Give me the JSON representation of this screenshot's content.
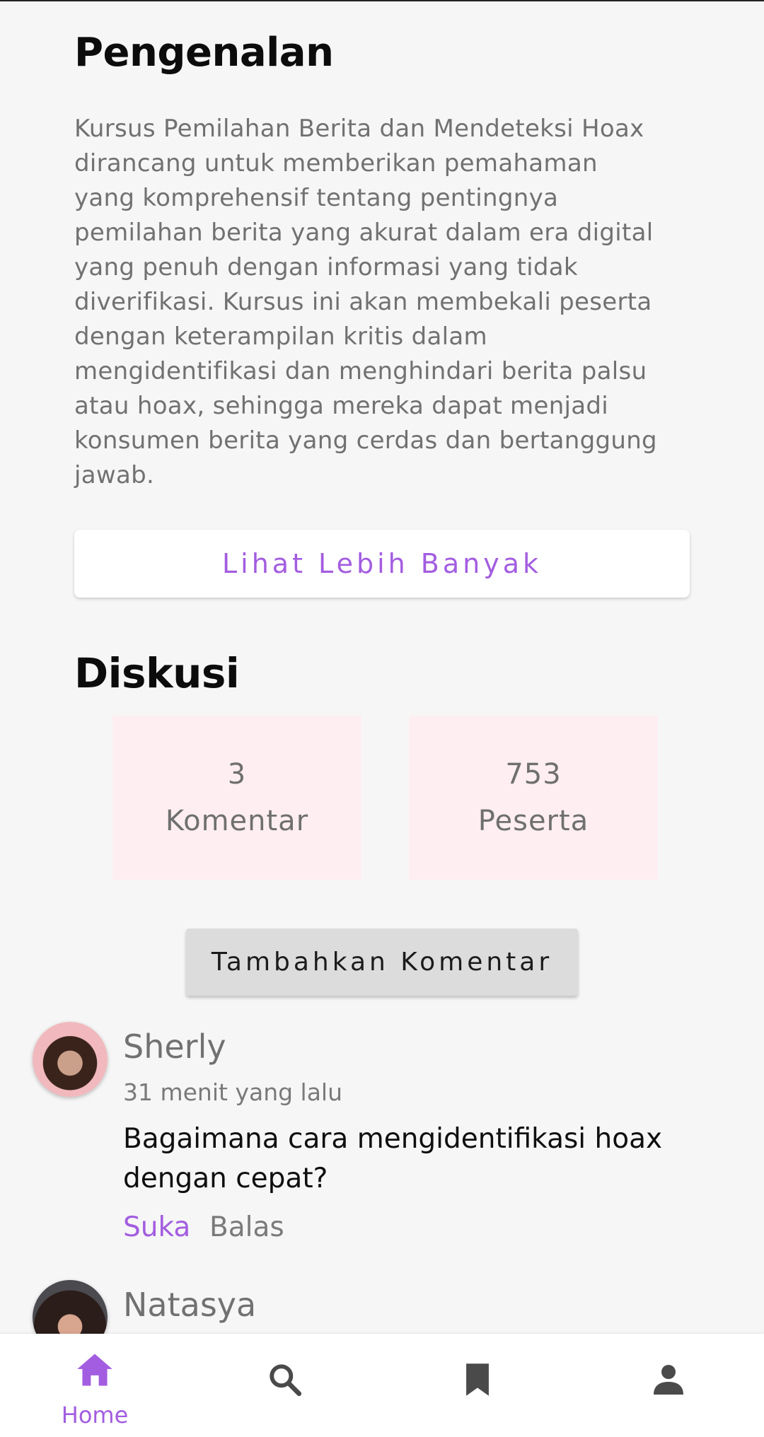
{
  "intro": {
    "title": "Pengenalan",
    "body": "Kursus Pemilahan Berita dan Mendeteksi Hoax dirancang untuk memberikan pemahaman yang komprehensif tentang pentingnya pemilahan berita yang akurat dalam era digital yang penuh dengan informasi yang tidak diverifikasi. Kursus ini akan membekali peserta dengan keterampilan kritis dalam mengidentifikasi dan menghindari berita palsu atau hoax, sehingga mereka dapat menjadi konsumen berita yang cerdas dan bertanggung jawab.",
    "more_button": "Lihat Lebih Banyak"
  },
  "discussion": {
    "title": "Diskusi",
    "stats": [
      {
        "value": "3",
        "label": "Komentar"
      },
      {
        "value": "753",
        "label": "Peserta"
      }
    ],
    "add_button": "Tambahkan Komentar",
    "comments": [
      {
        "name": "Sherly",
        "time": "31 menit yang lalu",
        "text": "Bagaimana cara mengidentifikasi hoax dengan cepat?",
        "like": "Suka",
        "reply": "Balas"
      },
      {
        "name": "Natasya"
      }
    ]
  },
  "nav": {
    "items": [
      {
        "label": "Home",
        "icon": "home-icon",
        "active": true
      },
      {
        "icon": "search-icon"
      },
      {
        "icon": "bookmark-icon"
      },
      {
        "icon": "profile-icon"
      }
    ]
  },
  "colors": {
    "accent": "#a35de0",
    "stat_card_bg": "#ffeef1",
    "background": "#f6f6f6",
    "icon_gray": "#4a4a4a"
  }
}
